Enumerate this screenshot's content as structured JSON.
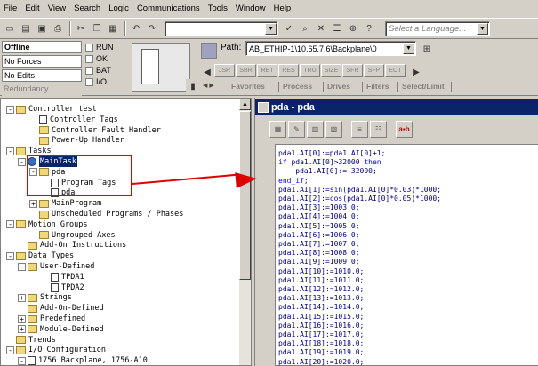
{
  "menubar": [
    "File",
    "Edit",
    "View",
    "Search",
    "Logic",
    "Communications",
    "Tools",
    "Window",
    "Help"
  ],
  "toolbar": {
    "language_placeholder": "Select a Language..."
  },
  "status": {
    "mode": "Offline",
    "forces": "No Forces",
    "edits": "No Edits",
    "redundancy": "Redundancy",
    "checks": [
      "RUN",
      "OK",
      "BAT",
      "I/O"
    ]
  },
  "path": {
    "label": "Path:",
    "value": "AB_ETHIP-1\\10.65.7.6\\Backplane\\0"
  },
  "instructions": [
    "JSR",
    "SBR",
    "RET",
    "RES",
    "TRU",
    "SIZE",
    "SFR",
    "SFP",
    "EOT"
  ],
  "instruction_tabs": [
    "Favorites",
    "Process",
    "Drives",
    "Filters",
    "Select/Limit"
  ],
  "tree": [
    {
      "label": "Controller test",
      "indent": 0,
      "pm": "-",
      "icon": "folder"
    },
    {
      "label": "Controller Tags",
      "indent": 2,
      "pm": "",
      "icon": "fdoc"
    },
    {
      "label": "Controller Fault Handler",
      "indent": 2,
      "pm": "",
      "icon": "folder"
    },
    {
      "label": "Power-Up Handler",
      "indent": 2,
      "pm": "",
      "icon": "folder"
    },
    {
      "label": "Tasks",
      "indent": 0,
      "pm": "-",
      "icon": "folder"
    },
    {
      "label": "MainTask",
      "indent": 1,
      "pm": "-",
      "icon": "task",
      "sel": true
    },
    {
      "label": "pda",
      "indent": 2,
      "pm": "-",
      "icon": "folder"
    },
    {
      "label": "Program Tags",
      "indent": 3,
      "pm": "",
      "icon": "fdoc"
    },
    {
      "label": "pda",
      "indent": 3,
      "pm": "",
      "icon": "fdoc"
    },
    {
      "label": "MainProgram",
      "indent": 2,
      "pm": "+",
      "icon": "folder"
    },
    {
      "label": "Unscheduled Programs / Phases",
      "indent": 2,
      "pm": "",
      "icon": "folder"
    },
    {
      "label": "Motion Groups",
      "indent": 0,
      "pm": "-",
      "icon": "folder"
    },
    {
      "label": "Ungrouped Axes",
      "indent": 2,
      "pm": "",
      "icon": "folder"
    },
    {
      "label": "Add-On Instructions",
      "indent": 1,
      "pm": "",
      "icon": "folder"
    },
    {
      "label": "Data Types",
      "indent": 0,
      "pm": "-",
      "icon": "folder"
    },
    {
      "label": "User-Defined",
      "indent": 1,
      "pm": "-",
      "icon": "folder"
    },
    {
      "label": "TPDA1",
      "indent": 3,
      "pm": "",
      "icon": "fdoc"
    },
    {
      "label": "TPDA2",
      "indent": 3,
      "pm": "",
      "icon": "fdoc"
    },
    {
      "label": "Strings",
      "indent": 1,
      "pm": "+",
      "icon": "folder"
    },
    {
      "label": "Add-On-Defined",
      "indent": 1,
      "pm": "",
      "icon": "folder"
    },
    {
      "label": "Predefined",
      "indent": 1,
      "pm": "+",
      "icon": "folder"
    },
    {
      "label": "Module-Defined",
      "indent": 1,
      "pm": "+",
      "icon": "folder"
    },
    {
      "label": "Trends",
      "indent": 0,
      "pm": "",
      "icon": "folder"
    },
    {
      "label": "I/O Configuration",
      "indent": 0,
      "pm": "-",
      "icon": "folder"
    },
    {
      "label": "1756 Backplane, 1756-A10",
      "indent": 1,
      "pm": "-",
      "icon": "fdoc"
    }
  ],
  "editor": {
    "title": "pda - pda",
    "lines": [
      "pda1.AI[0]:=pda1.AI[0]+1;",
      "if pda1.AI[0]>32000 then",
      "    pda1.AI[0]:=-32000;",
      "end_if;",
      "pda1.AI[1]:=sin(pda1.AI[0]*0.03)*1000;",
      "pda1.AI[2]:=cos(pda1.AI[0]*0.05)*1000;",
      "pda1.AI[3]:=1003.0;",
      "pda1.AI[4]:=1004.0;",
      "pda1.AI[5]:=1005.0;",
      "pda1.AI[6]:=1006.0;",
      "pda1.AI[7]:=1007.0;",
      "pda1.AI[8]:=1008.0;",
      "pda1.AI[9]:=1009.0;",
      "pda1.AI[10]:=1010.0;",
      "pda1.AI[11]:=1011.0;",
      "pda1.AI[12]:=1012.0;",
      "pda1.AI[13]:=1013.0;",
      "pda1.AI[14]:=1014.0;",
      "pda1.AI[15]:=1015.0;",
      "pda1.AI[16]:=1016.0;",
      "pda1.AI[17]:=1017.0;",
      "pda1.AI[18]:=1018.0;",
      "pda1.AI[19]:=1019.0;",
      "pda1.AI[20]:=1020.0;"
    ]
  },
  "colors": {
    "selection": "#0a246a",
    "highlight_box": "#e00000",
    "code_text": "#000080",
    "keyword": "#0000ff"
  }
}
